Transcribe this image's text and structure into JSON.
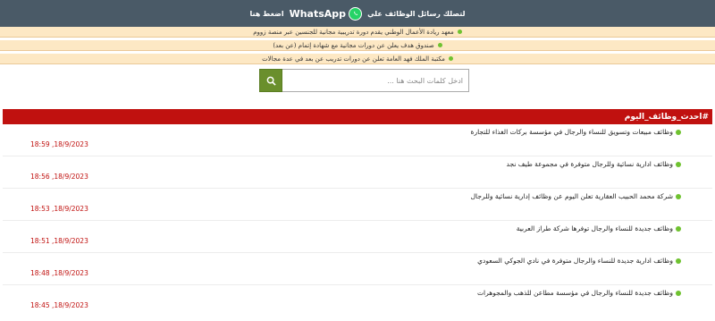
{
  "whatsapp_bar": {
    "text": "لتصلك رسائل الوظائف علي",
    "brand": "WhatsApp",
    "cta": "اضغط هنا"
  },
  "news": [
    {
      "text": "معهد ريادة الأعمال الوطني يقدم دورة تدريبية مجانية للجنسين عبر منصة زووم"
    },
    {
      "text": "صندوق هدف يعلن عن دورات مجانية مع شهادة إتمام (عن بعد)"
    },
    {
      "text": "مكتبة الملك فهد العامة تعلن عن دورات تدريب عن بعد في عدة مجالات"
    }
  ],
  "search": {
    "placeholder": "ادخل كلمات البحث هنا ..."
  },
  "section": {
    "title": "#احدث_وظائف_اليوم"
  },
  "jobs": [
    {
      "title": "وظائف مبيعات وتسويق للنساء والرجال في مؤسسة بركات الغذاء للتجارة",
      "date": "18:59 ,18/9/2023"
    },
    {
      "title": "وظائف ادارية نسائية وللرجال متوفرة في مجموعة طيف نجد",
      "date": "18:56 ,18/9/2023"
    },
    {
      "title": "شركة محمد الحبيب العقارية تعلن اليوم عن وظائف إدارية نسائية وللرجال",
      "date": "18:53 ,18/9/2023"
    },
    {
      "title": "وظائف جديدة للنساء والرجال توفرها شركة طراز العربية",
      "date": "18:51 ,18/9/2023"
    },
    {
      "title": "وظائف ادارية جديدة للنساء والرجال متوفرة في نادي الجوكي السعودي",
      "date": "18:48 ,18/9/2023"
    },
    {
      "title": "وظائف جديدة للنساء والرجال في مؤسسة مطاعن للذهب والمجوهرات",
      "date": "18:45 ,18/9/2023"
    }
  ],
  "colors": {
    "header_bar": "#4a5a67",
    "news_bg": "#fde8c4",
    "section_red": "#c0110f",
    "bullet_green": "#6fc230",
    "search_btn": "#6a8f2c"
  },
  "icons": [
    "whatsapp-icon",
    "search-icon",
    "bullet-dot"
  ]
}
